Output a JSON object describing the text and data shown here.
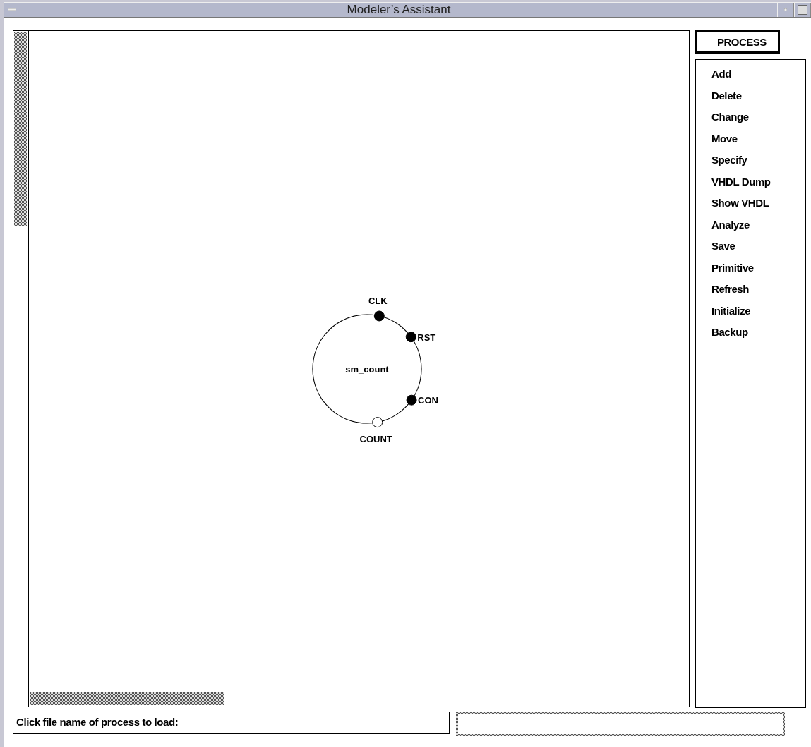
{
  "window": {
    "title": "Modeler’s Assistant"
  },
  "diagram": {
    "process": {
      "name": "sm_count"
    },
    "ports": [
      {
        "name": "CLK",
        "kind": "input"
      },
      {
        "name": "RST",
        "kind": "input"
      },
      {
        "name": "CON",
        "kind": "input"
      },
      {
        "name": "COUNT",
        "kind": "output"
      }
    ]
  },
  "mode_button": {
    "label": "PROCESS"
  },
  "menu": {
    "items": [
      "Add",
      "Delete",
      "Change",
      "Move",
      "Specify",
      "VHDL Dump",
      "Show VHDL",
      "Analyze",
      "Save",
      "Primitive",
      "Refresh",
      "Initialize",
      "Backup"
    ]
  },
  "status": {
    "prompt": "Click file name of process to load:"
  }
}
